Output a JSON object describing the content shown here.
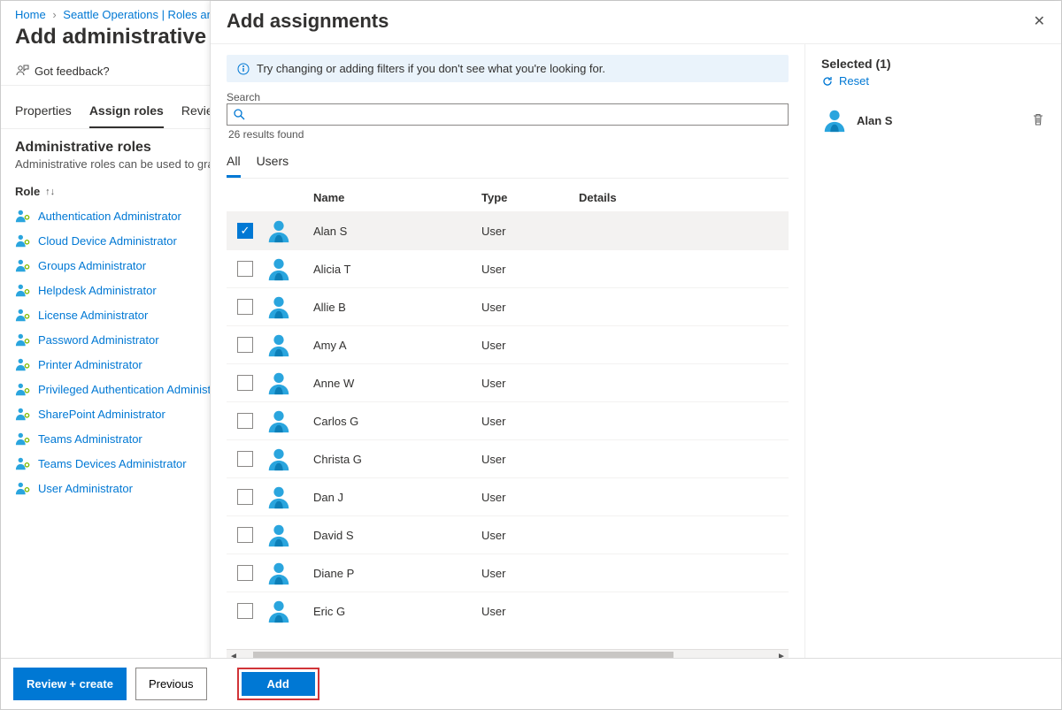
{
  "breadcrumb": {
    "home": "Home",
    "item2": "Seattle Operations | Roles and"
  },
  "page_title": "Add administrative uni",
  "feedback_label": "Got feedback?",
  "tabs": {
    "properties": "Properties",
    "assign_roles": "Assign roles",
    "review": "Review"
  },
  "admin_roles": {
    "title": "Administrative roles",
    "subtitle": "Administrative roles can be used to grant",
    "column": "Role",
    "items": [
      "Authentication Administrator",
      "Cloud Device Administrator",
      "Groups Administrator",
      "Helpdesk Administrator",
      "License Administrator",
      "Password Administrator",
      "Printer Administrator",
      "Privileged Authentication Administ",
      "SharePoint Administrator",
      "Teams Administrator",
      "Teams Devices Administrator",
      "User Administrator"
    ]
  },
  "bottom": {
    "review_create": "Review + create",
    "previous": "Previous",
    "add": "Add"
  },
  "panel": {
    "title": "Add assignments",
    "info": "Try changing or adding filters if you don't see what you're looking for.",
    "search_label": "Search",
    "results": "26 results found",
    "filter_tabs": {
      "all": "All",
      "users": "Users"
    },
    "columns": {
      "name": "Name",
      "type": "Type",
      "details": "Details"
    },
    "rows": [
      {
        "name": "Alan S",
        "type": "User",
        "selected": true
      },
      {
        "name": "Alicia T",
        "type": "User",
        "selected": false
      },
      {
        "name": "Allie B",
        "type": "User",
        "selected": false
      },
      {
        "name": "Amy A",
        "type": "User",
        "selected": false
      },
      {
        "name": "Anne W",
        "type": "User",
        "selected": false
      },
      {
        "name": "Carlos G",
        "type": "User",
        "selected": false
      },
      {
        "name": "Christa G",
        "type": "User",
        "selected": false
      },
      {
        "name": "Dan J",
        "type": "User",
        "selected": false
      },
      {
        "name": "David S",
        "type": "User",
        "selected": false
      },
      {
        "name": "Diane P",
        "type": "User",
        "selected": false
      },
      {
        "name": "Eric G",
        "type": "User",
        "selected": false
      }
    ],
    "selected_title": "Selected (1)",
    "reset": "Reset",
    "selected_items": [
      {
        "name": "Alan S"
      }
    ]
  }
}
